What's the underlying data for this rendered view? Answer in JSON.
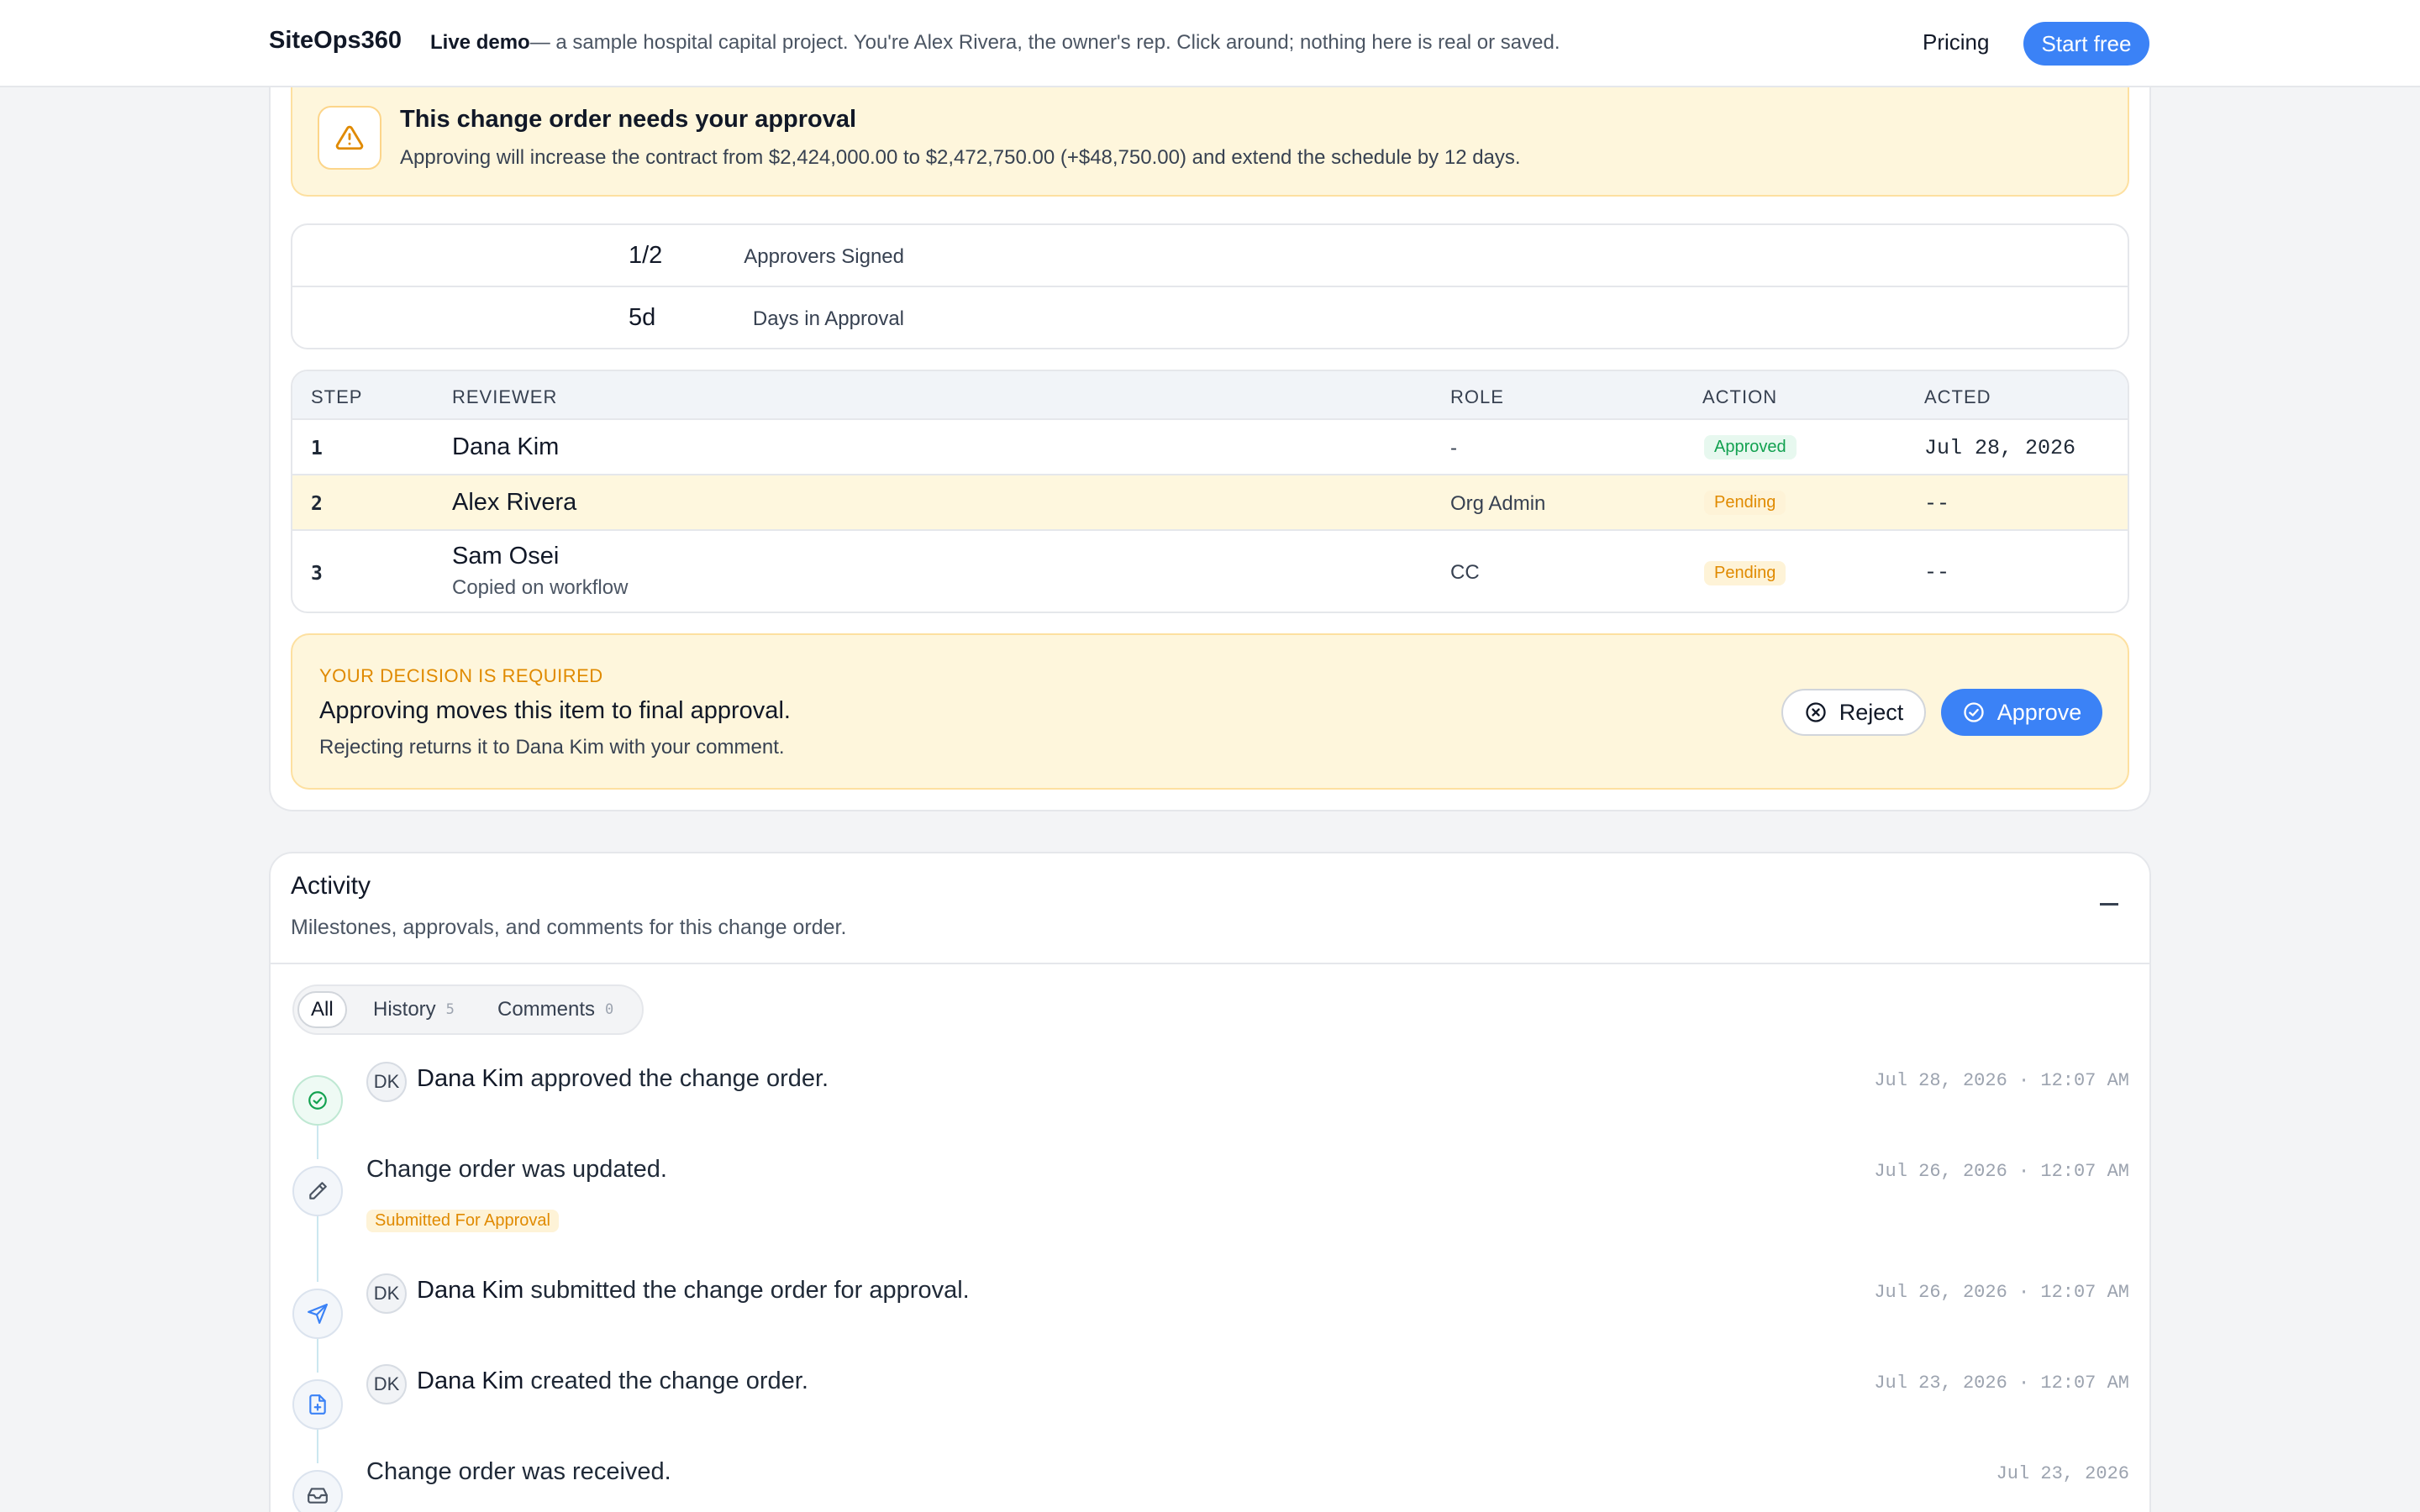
{
  "topbar": {
    "brand": "SiteOps360",
    "demo_label": "Live demo",
    "demo_text": "— a sample hospital capital project. You're Alex Rivera, the owner's rep. Click around; nothing here is real or saved.",
    "pricing": "Pricing",
    "start_free": "Start free"
  },
  "alert": {
    "icon": "warning-triangle-icon",
    "title": "This change order needs your approval",
    "text": "Approving will increase the contract from $2,424,000.00 to $2,472,750.00 (+$48,750.00) and extend the schedule by 12 days."
  },
  "stats": [
    {
      "label": "Approvers Signed",
      "value": "1/2"
    },
    {
      "label": "Days in Approval",
      "value": "5d"
    }
  ],
  "table": {
    "headers": [
      "STEP",
      "REVIEWER",
      "ROLE",
      "ACTION",
      "ACTED"
    ],
    "rows": [
      {
        "step": "1",
        "reviewer": "Dana Kim",
        "note": "",
        "role": "-",
        "action": "Approved",
        "acted": "Jul 28, 2026"
      },
      {
        "step": "2",
        "reviewer": "Alex Rivera",
        "note": "",
        "role": "Org Admin",
        "action": "Pending",
        "acted": "--"
      },
      {
        "step": "3",
        "reviewer": "Sam Osei",
        "note": "Copied on workflow",
        "role": "CC",
        "action": "Pending",
        "acted": "--"
      }
    ]
  },
  "decision": {
    "kicker": "YOUR DECISION IS REQUIRED",
    "title": "Approving moves this item to final approval.",
    "text": "Rejecting returns it to Dana Kim with your comment.",
    "reject": "Reject",
    "approve": "Approve"
  },
  "activity": {
    "title": "Activity",
    "subtitle": "Milestones, approvals, and comments for this change order.",
    "tabs": [
      {
        "label": "All",
        "count": ""
      },
      {
        "label": "History",
        "count": "5"
      },
      {
        "label": "Comments",
        "count": "0"
      }
    ],
    "events": [
      {
        "icon": "check-circle-icon",
        "avatar": "DK",
        "actor": "Dana Kim",
        "text": " approved the change order.",
        "time": "Jul 28, 2026 · 12:07 AM"
      },
      {
        "icon": "pencil-icon",
        "avatar": "",
        "actor": "",
        "text": "Change order was updated.",
        "badge": "Submitted For Approval",
        "time": "Jul 26, 2026 · 12:07 AM"
      },
      {
        "icon": "send-icon",
        "avatar": "DK",
        "actor": "Dana Kim",
        "text": " submitted the change order for approval.",
        "time": "Jul 26, 2026 · 12:07 AM"
      },
      {
        "icon": "file-plus-icon",
        "avatar": "DK",
        "actor": "Dana Kim",
        "text": " created the change order.",
        "time": "Jul 23, 2026 · 12:07 AM"
      },
      {
        "icon": "inbox-icon",
        "avatar": "",
        "actor": "",
        "text": "Change order was received.",
        "time": "Jul 23, 2026"
      }
    ]
  },
  "colors": {
    "accent": "#3b82f6",
    "warning_bg": "#fef6dc",
    "approved": "#12a150",
    "pending": "#e08a00"
  }
}
